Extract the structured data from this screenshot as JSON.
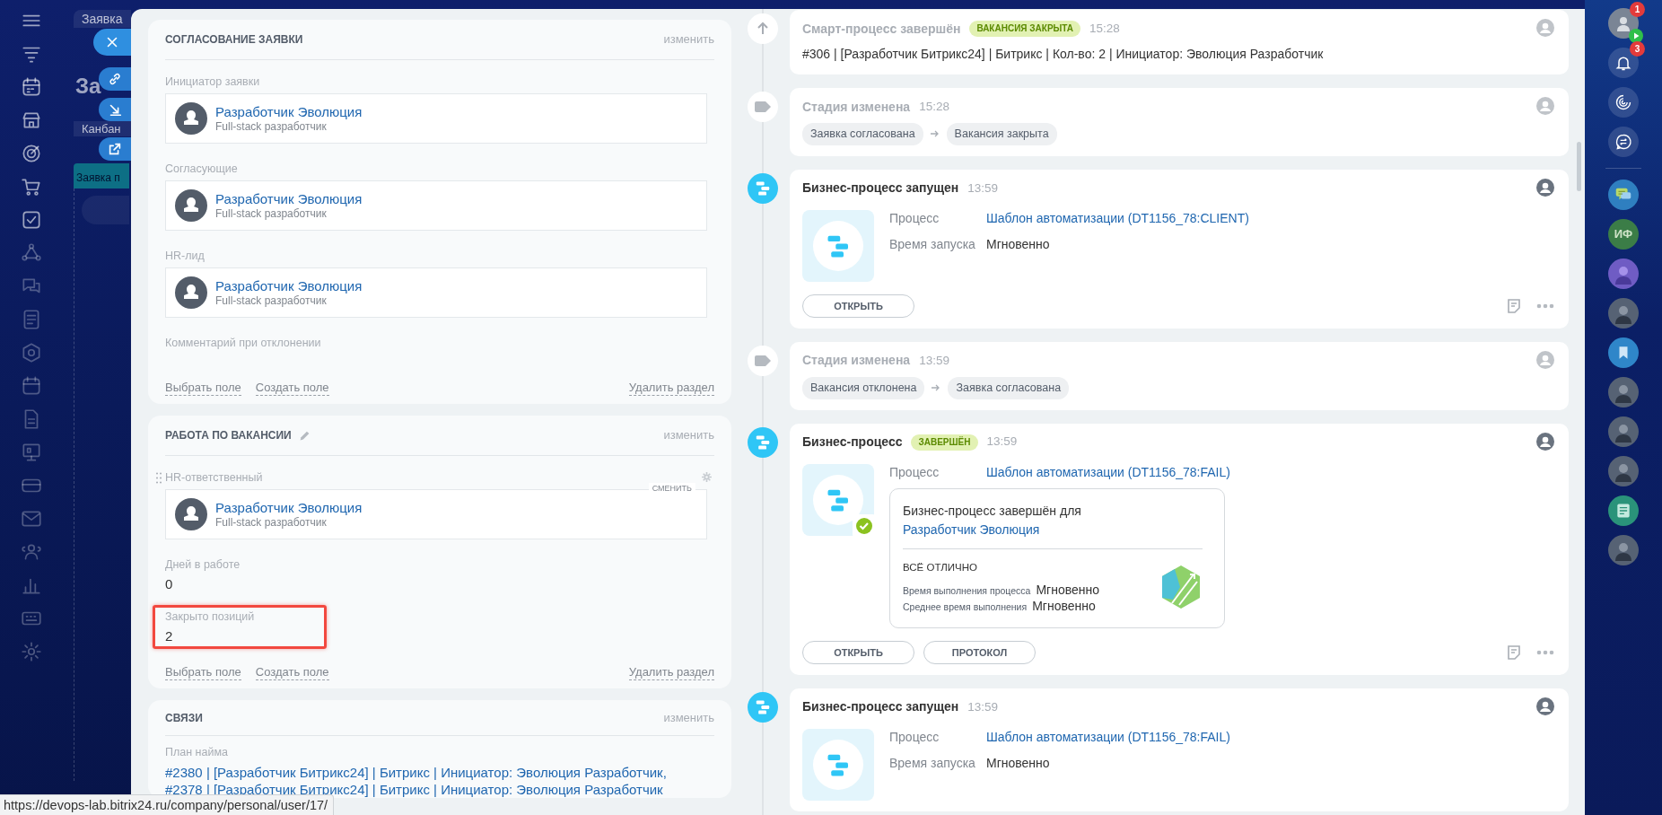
{
  "background_page": {
    "search": {
      "placeholder": "Заявка"
    },
    "title": "За",
    "view_tab": "Канбан",
    "column": "Заявка п"
  },
  "sections": [
    {
      "title": "СОГЛАСОВАНИЕ ЗАЯВКИ",
      "title_editable": false,
      "edit_link": "изменить",
      "fields": [
        {
          "kind": "user",
          "label": "Инициатор заявки",
          "name": "Разработчик Эволюция",
          "position": "Full-stack разработчик",
          "hovered": false
        },
        {
          "kind": "user",
          "label": "Согласующие",
          "name": "Разработчик Эволюция",
          "position": "Full-stack разработчик",
          "hovered": false
        },
        {
          "kind": "user",
          "label": "HR-лид",
          "name": "Разработчик Эволюция",
          "position": "Full-stack разработчик",
          "hovered": false
        },
        {
          "kind": "empty",
          "label": "Комментарий при отклонении"
        }
      ],
      "footer": {
        "select_field": "Выбрать поле",
        "create_field": "Создать поле",
        "delete_section": "Удалить раздел"
      }
    },
    {
      "title": "РАБОТА ПО ВАКАНСИИ",
      "title_editable": true,
      "edit_link": "изменить",
      "fields": [
        {
          "kind": "user",
          "label": "HR-ответственный",
          "name": "Разработчик Эволюция",
          "position": "Full-stack разработчик",
          "hovered": true,
          "change_label": "СМЕНИТЬ"
        },
        {
          "kind": "value",
          "label": "Дней в работе",
          "value": "0",
          "highlighted": false
        },
        {
          "kind": "value",
          "label": "Закрыто позиций",
          "value": "2",
          "highlighted": true
        }
      ],
      "footer": {
        "select_field": "Выбрать поле",
        "create_field": "Создать поле",
        "delete_section": "Удалить раздел"
      }
    },
    {
      "title": "СВЯЗИ",
      "title_editable": false,
      "edit_link": "изменить",
      "fields": [
        {
          "kind": "links",
          "label": "План найма",
          "links": [
            "#2380 | [Разработчик Битрикс24] | Битрикс | Инициатор: Эволюция Разработчик,",
            "#2378 | [Разработчик Битрикс24] | Битрикс | Инициатор: Эволюция Разработчик"
          ]
        }
      ]
    }
  ],
  "timeline": [
    {
      "kind": "smart_done",
      "title": "Смарт-процесс завершён",
      "badge": "ВАКАНСИЯ ЗАКРЫТА",
      "time": "15:28",
      "text": "#306 | [Разработчик Битрикс24] | Битрикс | Кол-во: 2 | Инициатор: Эволюция Разработчик"
    },
    {
      "kind": "stage",
      "title": "Стадия изменена",
      "time": "15:28",
      "from": "Заявка согласована",
      "to": "Вакансия закрыта"
    },
    {
      "kind": "bp",
      "title": "Бизнес-процесс запущен",
      "time": "13:59",
      "done": false,
      "rows": [
        {
          "label": "Процесс",
          "value": "Шаблон автоматизации (DT1156_78:CLIENT)",
          "link": true
        },
        {
          "label": "Время запуска",
          "value": "Мгновенно",
          "link": false
        }
      ],
      "buttons": [
        "ОТКРЫТЬ"
      ]
    },
    {
      "kind": "stage",
      "title": "Стадия изменена",
      "time": "13:59",
      "from": "Вакансия отклонена",
      "to": "Заявка согласована"
    },
    {
      "kind": "bp",
      "title": "Бизнес-процесс",
      "badge": "ЗАВЕРШЁН",
      "time": "13:59",
      "done": true,
      "rows": [
        {
          "label": "Процесс",
          "value": "Шаблон автоматизации (DT1156_78:FAIL)",
          "link": true
        }
      ],
      "result": {
        "text": "Бизнес-процесс завершён для ",
        "user": "Разработчик Эволюция",
        "status": "ВСЁ ОТЛИЧНО",
        "stats": [
          {
            "label": "Время выполнения процесса",
            "value": "Мгновенно"
          },
          {
            "label": "Среднее время выполнения",
            "value": "Мгновенно"
          }
        ]
      },
      "buttons": [
        "ОТКРЫТЬ",
        "ПРОТОКОЛ"
      ]
    },
    {
      "kind": "bp",
      "title": "Бизнес-процесс запущен",
      "time": "13:59",
      "done": false,
      "rows": [
        {
          "label": "Процесс",
          "value": "Шаблон автоматизации (DT1156_78:FAIL)",
          "link": true
        },
        {
          "label": "Время запуска",
          "value": "Мгновенно",
          "link": false
        }
      ]
    }
  ],
  "right_bar": {
    "profile_counter": "1",
    "notifications_counter": "3",
    "contacts": [
      {
        "kind": "chat",
        "color": "#2f7fc0"
      },
      {
        "kind": "initials",
        "initials": "ИФ",
        "color": "#3b7d47"
      },
      {
        "kind": "person",
        "color": "#6f5cc4"
      },
      {
        "kind": "photo",
        "color": "#566274"
      },
      {
        "kind": "bookmark",
        "color": "#2f86c9"
      },
      {
        "kind": "photo",
        "color": "#566274"
      },
      {
        "kind": "photo",
        "color": "#566274"
      },
      {
        "kind": "photo",
        "color": "#566274"
      },
      {
        "kind": "document",
        "color": "#2a937a"
      },
      {
        "kind": "photo",
        "color": "#566274"
      }
    ]
  },
  "status_bar": {
    "url": "https://devops-lab.bitrix24.ru/company/personal/user/17/"
  }
}
